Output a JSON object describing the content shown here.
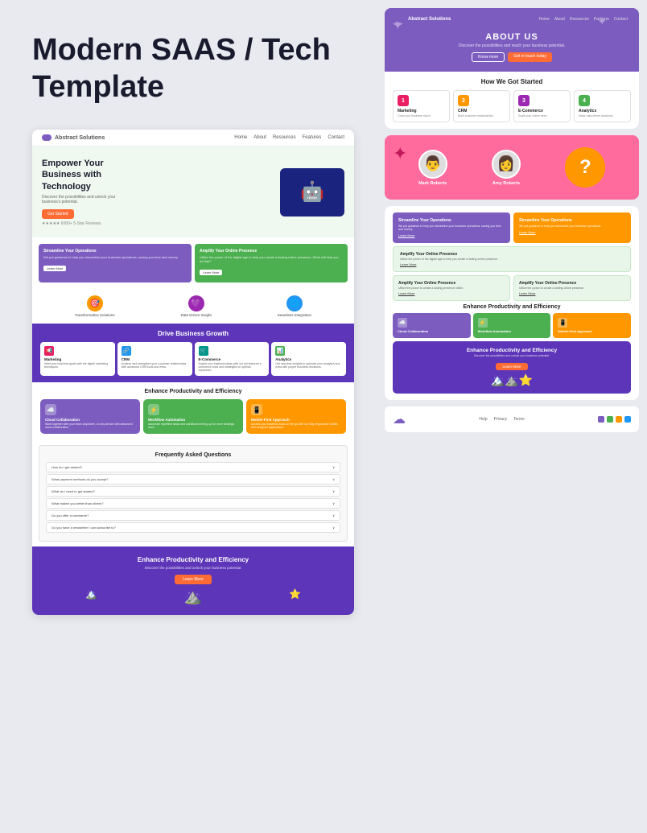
{
  "page": {
    "title": "Modern SAAS / Tech Template"
  },
  "left": {
    "main_title": "Modern SAAS / Tech Template",
    "preview": {
      "nav": {
        "logo": "Abstract Solutions",
        "links": [
          "Home",
          "About",
          "Resources",
          "Features",
          "Contact"
        ]
      },
      "hero": {
        "heading": "Empower Your Business with Technology",
        "subtext": "Discover the possibilities and unlock your business's potential.",
        "btn": "Get Started",
        "stars": "★★★★★ 6000+ 5-Star Reviews."
      },
      "features": [
        {
          "title": "Streamline Your Operations",
          "desc": "We put guidance to help you streamline your business operations, saving you time and money.",
          "btn": "Learn More",
          "color": "purple"
        },
        {
          "title": "Amplify Your Online Presence",
          "desc": "Utilize the power of the digital age to help you create a lasting online presence. What will help you do that?",
          "btn": "Learn More",
          "color": "green"
        }
      ],
      "icons": [
        {
          "label": "Transformative Solutions",
          "icon": "🎯"
        },
        {
          "label": "Data Driven Insight",
          "icon": "💜"
        },
        {
          "label": "Seamless Integration",
          "icon": "🌐"
        }
      ],
      "growth": {
        "title": "Drive Business Growth",
        "cards": [
          {
            "title": "Marketing",
            "desc": "Meet your business goals with the digital marketing techniques.",
            "icon": "📢",
            "color": "pink"
          },
          {
            "title": "CRM",
            "desc": "Achieve and strengthen your customer relationships with advanced CRM tools and extra.",
            "icon": "🔗",
            "color": "blue"
          },
          {
            "title": "E-Commerce",
            "desc": "Exploit your business ideas with our full-featured e-commerce tools and strategies for optimal expansion.",
            "icon": "🛒",
            "color": "teal"
          },
          {
            "title": "Analytics",
            "desc": "Get real-time insights to optimize your analytics and extra with proper business decisions.",
            "icon": "📊",
            "color": "green"
          }
        ]
      },
      "productivity": {
        "title": "Enhance Productivity and Efficiency",
        "cards": [
          {
            "title": "Cloud Collaboration",
            "desc": "Work together with your team anywhere, on any device with advanced cloud collaboration.",
            "icon": "☁️",
            "color": "purple"
          },
          {
            "title": "Workflow Automation",
            "desc": "Automate repetitive tasks and workflows freeing up for more strategic work.",
            "icon": "⚡",
            "color": "green"
          },
          {
            "title": "Mobile-First Approach",
            "desc": "Access your business tools on the go with our fully responsive mobile-first designed applications.",
            "icon": "📱",
            "color": "orange"
          }
        ]
      },
      "faq": {
        "title": "Frequently Asked Questions",
        "items": [
          "How do I get started?",
          "What payment methods do you accept?",
          "What do I need to get started?",
          "What makes you better than others?",
          "Do you offer a username?",
          "Do you have a newsletter I can subscribe to?"
        ]
      },
      "cta": {
        "title": "Enhance Productivity and Efficiency",
        "subtitle": "Discover the possibilities and unlock your business potential.",
        "btn": "Learn More"
      }
    }
  },
  "right": {
    "about": {
      "nav_logo": "Abstract Solutions",
      "nav_links": [
        "Home",
        "About",
        "Resources",
        "Partners",
        "Contact"
      ],
      "title": "ABOUT US",
      "subtitle": "Discover the possibilities and reach your business potential.",
      "btn1": "Know more",
      "btn2": "Get in touch today",
      "how_started": {
        "title": "How We Got Started",
        "cards": [
          {
            "num": "1",
            "title": "Marketing",
            "color": "n1"
          },
          {
            "num": "2",
            "title": "CRM",
            "color": "n2"
          },
          {
            "num": "3",
            "title": "E-Commerce",
            "color": "n3"
          },
          {
            "num": "4",
            "title": "Analytics",
            "color": "n4"
          }
        ]
      }
    },
    "testimonials": {
      "person1_name": "Mark Roberts",
      "person2_name": "Amy Roberts"
    },
    "features": {
      "cards": [
        {
          "title": "Streamline Your Operations",
          "desc": "We put guidance to help you streamline your business operations, saving you time and money.",
          "btn": "Learn More",
          "color": "purple"
        },
        {
          "title": "Streamline Your Operations",
          "desc": "We put guidance to help you streamline your business operations.",
          "btn": "Learn More",
          "color": "orange"
        }
      ],
      "amplify1": {
        "title": "Amplify Your Online Presence",
        "desc": "Utilize the power of the digital age to help you create a lasting online presence.",
        "btn": "Learn More"
      },
      "amplify2a": {
        "title": "Amplify Your Online Presence",
        "desc": "Utilize the power to create a lasting presence online.",
        "btn": "Learn More"
      },
      "amplify2b": {
        "title": "Amplify Your Online Presence",
        "desc": "Utilize the power to create a lasting online presence.",
        "btn": "Learn More"
      }
    },
    "enhance": {
      "title": "Enhance Productivity and Efficiency",
      "cards": [
        {
          "title": "Cloud Collaboration",
          "icon": "☁️",
          "color": "purple"
        },
        {
          "title": "Workflow Automation",
          "icon": "⚡",
          "color": "green"
        },
        {
          "title": "Mobile-First Approach",
          "icon": "📱",
          "color": "orange"
        }
      ],
      "cta": {
        "title": "Enhance Productivity and Efficiency",
        "subtitle": "Discover the possibilities and unlock your business potential.",
        "btn": "Learn More"
      }
    },
    "footer": {
      "links": [
        "Help",
        "Privacy",
        "Terms"
      ],
      "colors": [
        "#7c5cbf",
        "#4caf50",
        "#ff9800",
        "#2196f3"
      ]
    }
  }
}
